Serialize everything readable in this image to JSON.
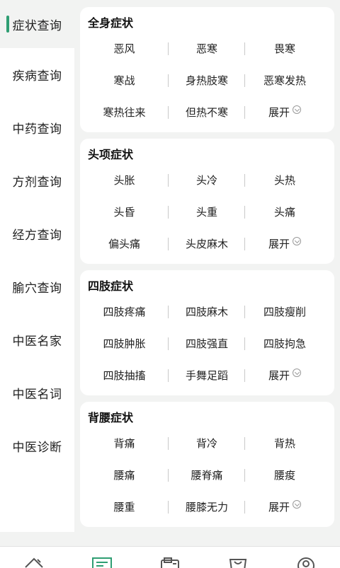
{
  "sidebar": {
    "items": [
      {
        "label": "症状查询"
      },
      {
        "label": "疾病查询"
      },
      {
        "label": "中药查询"
      },
      {
        "label": "方剂查询"
      },
      {
        "label": "经方查询"
      },
      {
        "label": "腧穴查询"
      },
      {
        "label": "中医名家"
      },
      {
        "label": "中医名词"
      },
      {
        "label": "中医诊断"
      }
    ]
  },
  "sections": [
    {
      "title": "全身症状",
      "rows": [
        [
          "恶风",
          "恶寒",
          "畏寒"
        ],
        [
          "寒战",
          "身热肢寒",
          "恶寒发热"
        ],
        [
          "寒热往来",
          "但热不寒",
          "展开"
        ]
      ]
    },
    {
      "title": "头项症状",
      "rows": [
        [
          "头胀",
          "头冷",
          "头热"
        ],
        [
          "头昏",
          "头重",
          "头痛"
        ],
        [
          "偏头痛",
          "头皮麻木",
          "展开"
        ]
      ]
    },
    {
      "title": "四肢症状",
      "rows": [
        [
          "四肢疼痛",
          "四肢麻木",
          "四肢瘦削"
        ],
        [
          "四肢肿胀",
          "四肢强直",
          "四肢拘急"
        ],
        [
          "四肢抽搐",
          "手舞足蹈",
          "展开"
        ]
      ]
    },
    {
      "title": "背腰症状",
      "rows": [
        [
          "背痛",
          "背冷",
          "背热"
        ],
        [
          "腰痛",
          "腰脊痛",
          "腰痠"
        ],
        [
          "腰重",
          "腰膝无力",
          "展开"
        ]
      ]
    }
  ],
  "colors": {
    "accent": "#2f9e73",
    "background": "#f2f3f2",
    "card": "#ffffff"
  },
  "bottom_nav": {
    "icons": [
      "home-icon",
      "symptom-list-icon",
      "news-card-icon",
      "shopping-bag-icon",
      "profile-icon"
    ]
  }
}
